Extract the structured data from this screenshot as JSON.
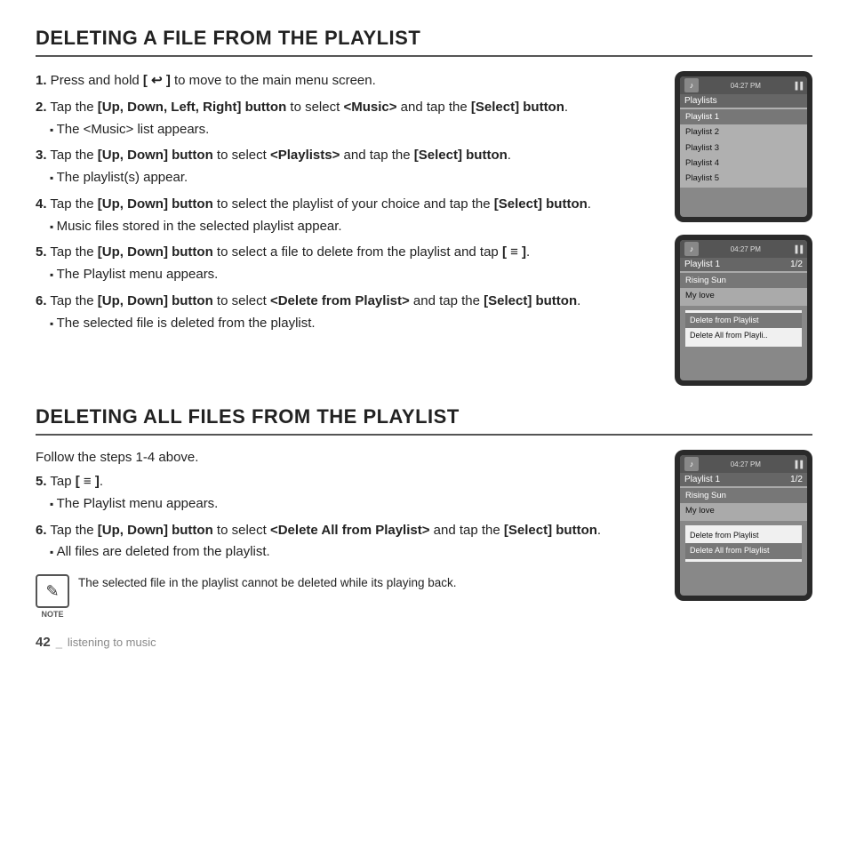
{
  "section1": {
    "title": "DELETING A FILE FROM THE PLAYLIST",
    "steps": [
      {
        "num": "1.",
        "text": "Press and hold ",
        "bold": "[ ↩ ]",
        "text2": " to move to the main menu screen."
      },
      {
        "num": "2.",
        "text": "Tap the ",
        "bold": "[Up, Down, Left, Right] button",
        "text2": " to select ",
        "bold2": "<Music>",
        "text3": " and tap the ",
        "bold3": "[Select] button",
        "text4": ".",
        "bullet": "The <Music> list appears."
      },
      {
        "num": "3.",
        "text": "Tap the ",
        "bold": "[Up, Down] button",
        "text2": " to select ",
        "bold2": "<Playlists>",
        "text3": " and tap the ",
        "bold3": "[Select] button",
        "text4": ".",
        "bullet": "The playlist(s) appear."
      },
      {
        "num": "4.",
        "text": "Tap the ",
        "bold": "[Up, Down] button",
        "text2": " to select the playlist of your choice and tap the ",
        "bold3": "[Select] button",
        "text4": ".",
        "bullet": "Music files stored in the selected playlist appear."
      },
      {
        "num": "5.",
        "text": "Tap the ",
        "bold": "[Up, Down] button",
        "text2": " to select a file to delete from the playlist and tap ",
        "bold3": "[ ≡ ]",
        "text4": ".",
        "bullet": "The Playlist menu appears."
      },
      {
        "num": "6.",
        "text": "Tap the ",
        "bold": "[Up, Down] button",
        "text2": " to select ",
        "bold2": "<Delete from Playlist>",
        "text3": " and tap the ",
        "bold3": "[Select] button",
        "text4": ".",
        "bullet": "The selected file is deleted from the playlist."
      }
    ],
    "device1": {
      "time": "04:27 PM",
      "title": "Playlists",
      "items": [
        "Playlist 1",
        "Playlist 2",
        "Playlist 3",
        "Playlist 4",
        "Playlist 5"
      ],
      "selected": 0
    },
    "device2": {
      "time": "04:27 PM",
      "title": "Playlist 1",
      "pageinfo": "1/2",
      "items": [
        "Rising Sun",
        "My love"
      ],
      "selected": 0,
      "menu": [
        "Delete from Playlist",
        "Delete All from Playli.."
      ],
      "menu_selected": 0
    }
  },
  "section2": {
    "title": "DELETING ALL FILES FROM THE PLAYLIST",
    "intro": "Follow the steps 1-4 above.",
    "steps": [
      {
        "num": "5.",
        "text": "Tap ",
        "bold": "[ ≡ ]",
        "text2": ".",
        "bullet": "The Playlist menu appears."
      },
      {
        "num": "6.",
        "text": "Tap the ",
        "bold": "[Up, Down] button",
        "text2": " to select ",
        "bold2": "<Delete All from Playlist>",
        "text3": " and tap the ",
        "bold3": "[Select] button",
        "text4": ".",
        "bullet": "All files are deleted from the playlist."
      }
    ],
    "device3": {
      "time": "04:27 PM",
      "title": "Playlist 1",
      "pageinfo": "1/2",
      "items": [
        "Rising Sun",
        "My love"
      ],
      "selected": 0,
      "menu": [
        "Delete from Playlist",
        "Delete All from Playlist"
      ],
      "menu_selected": 1
    }
  },
  "note": {
    "icon": "✎",
    "label": "NOTE",
    "text": "The selected file in the playlist cannot be deleted while its playing back."
  },
  "footer": {
    "page_num": "42",
    "separator": "_",
    "text": "listening to music"
  }
}
